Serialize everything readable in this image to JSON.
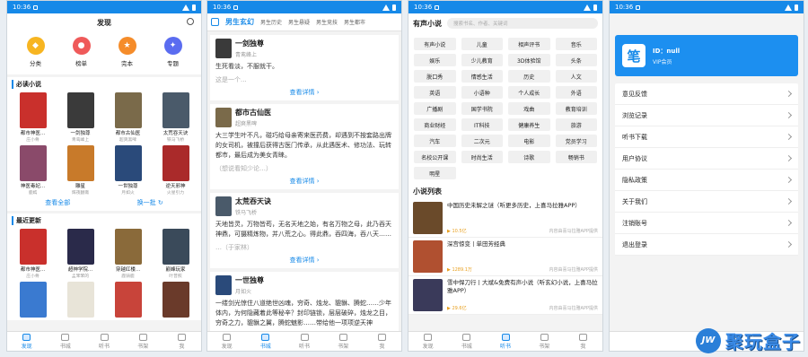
{
  "status_time": "10:36",
  "colors": {
    "primary": "#1689e8",
    "watermark": "#3a8ae6"
  },
  "bottom_nav": [
    "发现",
    "书城",
    "听书",
    "书架",
    "我"
  ],
  "screen1": {
    "title": "发现",
    "categories": [
      {
        "label": "分类",
        "color": "#f7b521",
        "icon": "category-icon"
      },
      {
        "label": "榜单",
        "color": "#ef5a5a",
        "icon": "rank-icon"
      },
      {
        "label": "完本",
        "color": "#f58c2a",
        "icon": "star-icon"
      },
      {
        "label": "专题",
        "color": "#5a6cf0",
        "icon": "topic-icon"
      }
    ],
    "must_read": {
      "title": "必读小说",
      "books": [
        {
          "title": "都市神医...",
          "author": "庄小骨",
          "color": "#c9302c"
        },
        {
          "title": "一剑独尊",
          "author": "青鸾峰上",
          "color": "#3a3a3a"
        },
        {
          "title": "都市古仙医",
          "author": "超爽黑啤",
          "color": "#7a6a4a"
        },
        {
          "title": "太荒吞天诀",
          "author": "铁马飞桥",
          "color": "#4a5a6a"
        },
        {
          "title": "神医毒妃...",
          "author": "鹿嫣",
          "color": "#8a4a6a"
        },
        {
          "title": "雕星",
          "author": "辉夜翻斋",
          "color": "#c87a2a"
        },
        {
          "title": "一世独尊",
          "author": "月如火",
          "color": "#2a4a7a"
        },
        {
          "title": "逆天邪神",
          "author": "火星引力",
          "color": "#aa2a2a"
        }
      ],
      "view_all": "查看全部",
      "refresh": "换一批"
    },
    "recent": {
      "title": "最近更新",
      "books": [
        {
          "title": "都市神医...",
          "author": "庄小骨",
          "color": "#c9302c"
        },
        {
          "title": "超神学院...",
          "author": "孟笨笨的",
          "color": "#2a2a4a"
        },
        {
          "title": "穿越红楼...",
          "author": "鹿骑鹿",
          "color": "#8a6a3a"
        },
        {
          "title": "巅峰玩家",
          "author": "叶普照",
          "color": "#3a4a5a"
        },
        {
          "title": "",
          "author": "",
          "color": "#3a7ad0"
        },
        {
          "title": "",
          "author": "",
          "color": "#e8e4d8"
        },
        {
          "title": "",
          "author": "",
          "color": "#c8443a"
        },
        {
          "title": "",
          "author": "",
          "color": "#6a3a2a"
        }
      ]
    }
  },
  "screen2": {
    "tabs": [
      "男生玄幻",
      "男生历史",
      "男生悬疑",
      "男生竞技",
      "男生都市"
    ],
    "cards": [
      {
        "title": "一剑独尊",
        "author": "青鸾峰上",
        "color": "#3a3a3a",
        "body": "生死看淡，不服就干。",
        "faded": "这是一个..."
      },
      {
        "title": "都市古仙医",
        "author": "超爽黑啤",
        "color": "#7a6a4a",
        "body": "大三学生叶不凡，碰巧给母亲寄来医药费，却遇到不按套路出牌的女司机，被撞后获得古医门传承，从此遇医术、修功法、玩转都市，最后成为美女青睐。",
        "faded": "（想说看知少论…）"
      },
      {
        "title": "太荒吞天诀",
        "author": "铁马飞桥",
        "color": "#4a5a6a",
        "body": "天地皆灵，万物皆苟，无名天地之始，有名万物之母，此乃吞天神鼎，可摄精炼物，并八荒之心。得此鼎，吞四海，吞八天……",
        "faded": "…（于家林）"
      },
      {
        "title": "一世独尊",
        "author": "月如火",
        "color": "#2a4a7a",
        "body": "一缕剑光惊住八道绝世凶魂，穷奇、烛龙、貔貅、腾蛇……少年体内，为何隐藏着此等秘辛？封印链锁，层层破碎，烛龙之目，穷奇之力，貔貅之翼，腾蛇魅影……带给他一项项逆天神"
      }
    ],
    "more": "查看详情"
  },
  "screen3": {
    "title": "有声小说",
    "search_placeholder": "搜索书名、作者、关键词",
    "tags": [
      "有声小说",
      "儿童",
      "相声评书",
      "音乐",
      "娱乐",
      "少儿教育",
      "3D体验馆",
      "头条",
      "脱口秀",
      "情感生活",
      "历史",
      "人文",
      "英语",
      "小语种",
      "个人成长",
      "外语",
      "广播剧",
      "国学书院",
      "戏曲",
      "教育培训",
      "商业财经",
      "IT科技",
      "健康养生",
      "旅游",
      "汽车",
      "二次元",
      "电影",
      "党员学习",
      "名校公开课",
      "时尚生活",
      "诗歌",
      "畅销书",
      "明星"
    ],
    "list_title": "小说列表",
    "list": [
      {
        "title": "中国历史未解之谜（听更多历史，上喜马拉雅APP）",
        "plays": "10.5亿",
        "source": "内容由喜马拉雅APP提供",
        "color": "#6a4a2a"
      },
      {
        "title": "深宫惊变丨单田芳经典",
        "plays": "1289.1万",
        "source": "内容由喜马拉雅APP提供",
        "color": "#b05030"
      },
      {
        "title": "雪中悍刀行丨大斌&免费有声小说（听玄幻小说，上喜马拉雅APP）",
        "plays": "29.6亿",
        "source": "内容由喜马拉雅APP提供",
        "color": "#3a3a5a"
      }
    ]
  },
  "screen4": {
    "logo_char": "笔",
    "user_id": "ID：null",
    "vip": "VIP会员",
    "menu": [
      "意见反馈",
      "浏览记录",
      "听书下载",
      "用户协议",
      "隐私政策",
      "关于我们",
      "注销账号",
      "退出登录"
    ]
  },
  "watermark": {
    "badge": "JW",
    "text": "聚玩盒子"
  }
}
